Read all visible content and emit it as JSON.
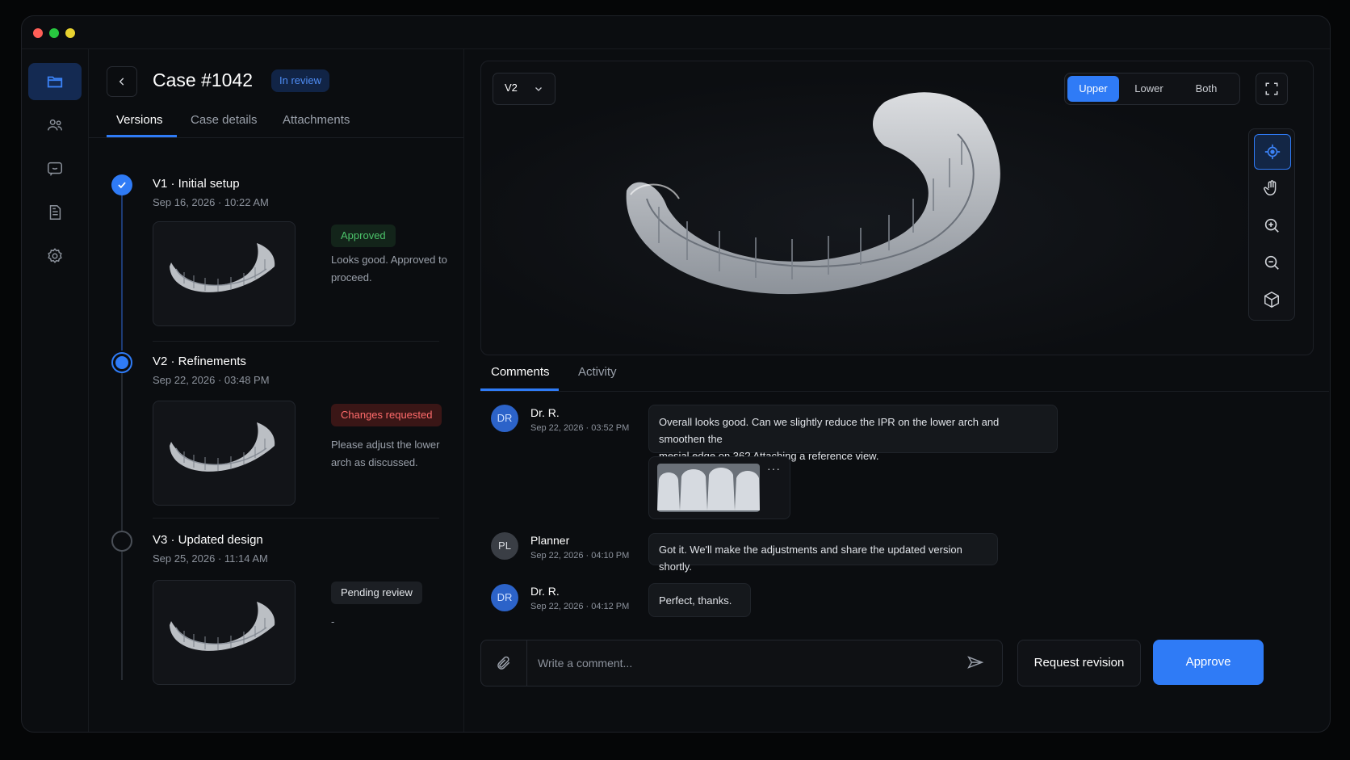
{
  "window": {
    "controls": [
      "close",
      "minimize",
      "maximize"
    ]
  },
  "rail": {
    "items": [
      {
        "icon": "folder-icon",
        "active": true
      },
      {
        "icon": "users-icon",
        "active": false
      },
      {
        "icon": "chat-icon",
        "active": false
      },
      {
        "icon": "document-icon",
        "active": false
      },
      {
        "icon": "settings-icon",
        "active": false
      }
    ]
  },
  "case": {
    "title": "Case #1042",
    "status": "In review"
  },
  "tabs": {
    "versions": "Versions",
    "details": "Case details",
    "attachments": "Attachments"
  },
  "versions": [
    {
      "title": "V1 · Initial setup",
      "date": "Sep 16, 2026 · 10:22 AM",
      "status": "Approved",
      "note": "Looks good. Approved to proceed.",
      "state": "done"
    },
    {
      "title": "V2 · Refinements",
      "date": "Sep 22, 2026 · 03:48 PM",
      "status": "Changes requested",
      "note": "Please adjust the lower arch as discussed.",
      "state": "current"
    },
    {
      "title": "V3 · Updated design",
      "date": "Sep 25, 2026 · 11:14 AM",
      "status": "Pending review",
      "note": "-",
      "state": "pending"
    }
  ],
  "viewer": {
    "version_select": "V2",
    "arch": {
      "upper": "Upper",
      "lower": "Lower",
      "both": "Both",
      "selected": "Upper"
    },
    "tools": [
      "target-icon",
      "hand-icon",
      "zoom-in-icon",
      "zoom-out-icon",
      "cube-icon"
    ]
  },
  "comment_tabs": {
    "comments": "Comments",
    "activity": "Activity"
  },
  "comments": [
    {
      "initials": "DR",
      "author": "Dr. R.",
      "time": "Sep 22, 2026 · 03:52 PM",
      "text_line1": "Overall looks good. Can we slightly reduce the IPR on the lower arch and smoothen the",
      "text_line2": "mesial edge on 36? Attaching a reference view."
    },
    {
      "initials": "PL",
      "author": "Planner",
      "time": "Sep 22, 2026 · 04:10 PM",
      "text": "Got it. We'll make the adjustments and share the updated version shortly."
    },
    {
      "initials": "DR",
      "author": "Dr. R.",
      "time": "Sep 22, 2026 · 04:12 PM",
      "text": "Perfect, thanks."
    }
  ],
  "attachment_menu": "···",
  "composer": {
    "placeholder": "Write a comment..."
  },
  "actions": {
    "request_revision": "Request revision",
    "approve": "Approve"
  },
  "colors": {
    "accent": "#2f7bf6",
    "approved": "#4cc36a",
    "changes": "#ff6b6b"
  }
}
